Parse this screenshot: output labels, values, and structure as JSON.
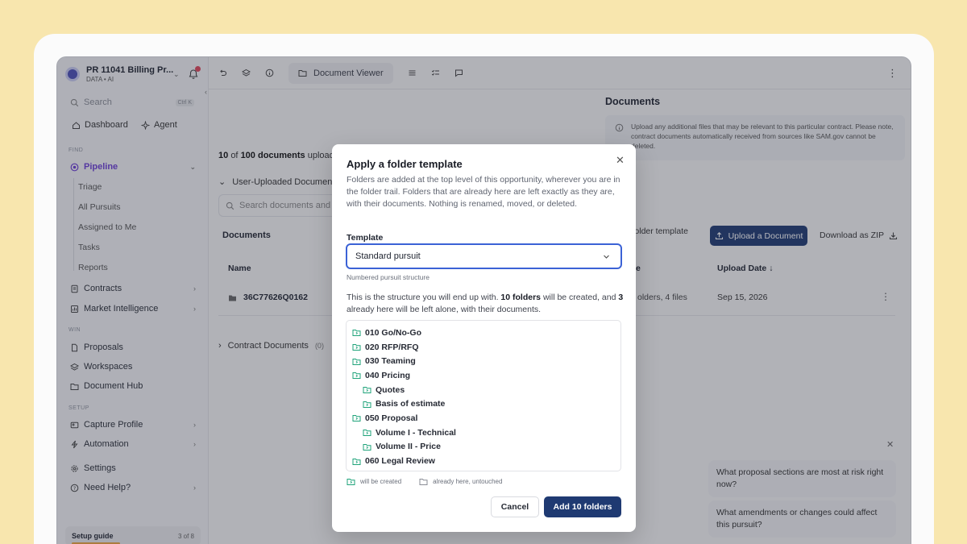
{
  "workspace": {
    "name": "PR 11041 Billing Pr...",
    "subtitle": "DATA • AI"
  },
  "sidebar": {
    "search_placeholder": "Search",
    "search_shortcut": "Ctrl K",
    "dashboard": "Dashboard",
    "agent": "Agent",
    "sections": {
      "find": "FIND",
      "win": "WIN",
      "setup": "SETUP"
    },
    "pipeline": "Pipeline",
    "pipeline_sub": [
      "Triage",
      "All Pursuits",
      "Assigned to Me",
      "Tasks",
      "Reports"
    ],
    "contracts": "Contracts",
    "market_intelligence": "Market Intelligence",
    "proposals": "Proposals",
    "workspaces": "Workspaces",
    "document_hub": "Document Hub",
    "capture_profile": "Capture Profile",
    "automation": "Automation",
    "settings": "Settings",
    "need_help": "Need Help?",
    "setup_guide": "Setup guide",
    "setup_progress": "3 of 8"
  },
  "topbar": {
    "document_viewer": "Document Viewer"
  },
  "main": {
    "documents_title": "Documents",
    "info_text": "Upload any additional files that may be relevant to this particular contract. Please note, contract documents automatically received from sources like SAM.gov cannot be deleted.",
    "count_shown": "10",
    "count_of": "of",
    "count_total": "100 documents",
    "count_suffix": "upload",
    "user_uploaded": "User-Uploaded Documen",
    "search_placeholder": "Search documents and",
    "documents_header": "Documents",
    "folder_template_btn": "Folder template",
    "upload_btn": "Upload a Document",
    "download_zip_btn": "Download as ZIP",
    "col_name": "Name",
    "col_e": "e",
    "col_upload_date": "Upload Date",
    "row_name": "36C77626Q0162",
    "row_meta": "olders, 4 files",
    "row_date": "Sep 15, 2026",
    "contract_docs": "Contract Documents",
    "contract_docs_count": "(0)"
  },
  "chat": {
    "suggestions": [
      "What proposal sections are most at risk right now?",
      "What amendments or changes could affect this pursuit?"
    ]
  },
  "modal": {
    "title": "Apply a folder template",
    "description": "Folders are added at the top level of this opportunity, wherever you are in the folder trail. Folders that are already here are left exactly as they are, with their documents. Nothing is renamed, moved, or deleted.",
    "template_label": "Template",
    "template_value": "Standard pursuit",
    "template_hint": "Numbered pursuit structure",
    "summary_a": "This is the structure you will end up with.",
    "summary_b": "10 folders",
    "summary_c": "will be created, and",
    "summary_d": "3",
    "summary_e": "already here will be left alone, with their documents.",
    "tree": [
      {
        "label": "010 Go/No-Go",
        "level": 0
      },
      {
        "label": "020 RFP/RFQ",
        "level": 0
      },
      {
        "label": "030 Teaming",
        "level": 0
      },
      {
        "label": "040 Pricing",
        "level": 0
      },
      {
        "label": "Quotes",
        "level": 1
      },
      {
        "label": "Basis of estimate",
        "level": 1
      },
      {
        "label": "050 Proposal",
        "level": 0
      },
      {
        "label": "Volume I - Technical",
        "level": 1
      },
      {
        "label": "Volume II - Price",
        "level": 1
      },
      {
        "label": "060 Legal Review",
        "level": 0
      }
    ],
    "legend_created": "will be created",
    "legend_untouched": "already here, untouched",
    "cancel": "Cancel",
    "confirm": "Add 10 folders"
  },
  "colors": {
    "accent": "#1f3a72",
    "purple_active": "#6d3fd6",
    "folder_green": "#1fa37a",
    "focus_blue": "#3b62d6",
    "background": "#f8e6ae"
  }
}
